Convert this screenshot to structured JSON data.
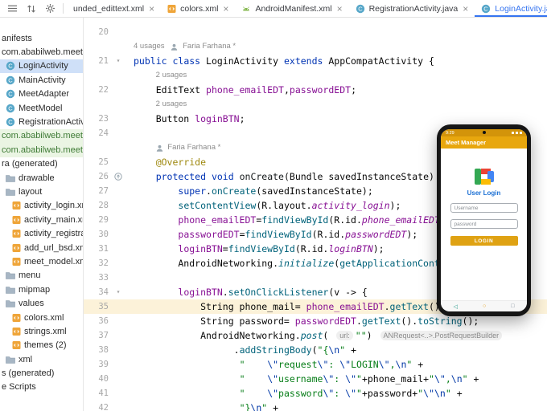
{
  "theme": {
    "accent": "#3574F0",
    "selection_bg": "#CFE0F8",
    "vcs_added_bg": "#EAF5E3",
    "vcs_added_text": "#3F7B36",
    "caret_line_bg": "#FCF2D9",
    "syntax": {
      "keyword": "#0033B3",
      "field": "#871094",
      "method_call": "#00627A",
      "string": "#067D17",
      "escape": "#0037A6",
      "annotation": "#9E880D",
      "text": "#080808",
      "inlay_hint": "#8C8C8C"
    }
  },
  "toolbar": {
    "icons": [
      "menu",
      "sort",
      "gear"
    ]
  },
  "tabs": [
    {
      "label": "unded_edittext.xml",
      "icon": null,
      "active": false,
      "closable": true
    },
    {
      "label": "colors.xml",
      "icon": "xml",
      "active": false,
      "closable": true
    },
    {
      "label": "AndroidManifest.xml",
      "icon": "manifest",
      "active": false,
      "closable": true
    },
    {
      "label": "RegistrationActivity.java",
      "icon": "cls",
      "active": false,
      "closable": true
    },
    {
      "label": "LoginActivity.ja",
      "icon": "cls",
      "active": true,
      "closable": false
    }
  ],
  "close_glyph": "×",
  "project_tree": {
    "items": [
      {
        "label": "anifests",
        "icon": null,
        "level": 0
      },
      {
        "label": "com.ababilweb.meetm",
        "icon": null,
        "level": 0
      },
      {
        "label": "LoginActivity",
        "icon": "cls",
        "level": 1,
        "state": "selected"
      },
      {
        "label": "MainActivity",
        "icon": "cls",
        "level": 1
      },
      {
        "label": "MeetAdapter",
        "icon": "cls",
        "level": 1
      },
      {
        "label": "MeetModel",
        "icon": "cls",
        "level": 1
      },
      {
        "label": "RegistrationActivity",
        "icon": "cls",
        "level": 1
      },
      {
        "label": "com.ababilweb.meetma",
        "icon": null,
        "level": 0,
        "state": "vcs"
      },
      {
        "label": "com.ababilweb.meetma",
        "icon": null,
        "level": 0,
        "state": "vcs"
      },
      {
        "label": "ra (generated)",
        "icon": null,
        "level": 0
      },
      {
        "label": "drawable",
        "icon": "folder",
        "level": 1
      },
      {
        "label": "layout",
        "icon": "folder",
        "level": 1
      },
      {
        "label": "activity_login.xml",
        "icon": "xml",
        "level": 2
      },
      {
        "label": "activity_main.xml",
        "icon": "xml",
        "level": 2
      },
      {
        "label": "activity_registration.x",
        "icon": "xml",
        "level": 2
      },
      {
        "label": "add_url_bsd.xml",
        "icon": "xml",
        "level": 2
      },
      {
        "label": "meet_model.xml",
        "icon": "xml",
        "level": 2
      },
      {
        "label": "menu",
        "icon": "folder",
        "level": 1
      },
      {
        "label": "mipmap",
        "icon": "folder",
        "level": 1
      },
      {
        "label": "values",
        "icon": "folder",
        "level": 1
      },
      {
        "label": "colors.xml",
        "icon": "xml",
        "level": 2
      },
      {
        "label": "strings.xml",
        "icon": "xml",
        "level": 2
      },
      {
        "label": "themes (2)",
        "icon": "xml",
        "level": 2
      },
      {
        "label": "xml",
        "icon": "folder",
        "level": 1
      },
      {
        "label": "s (generated)",
        "icon": null,
        "level": 0
      },
      {
        "label": "e Scripts",
        "icon": null,
        "level": 0
      }
    ]
  },
  "editor": {
    "lines": [
      {
        "num": 20,
        "tokens": []
      },
      {
        "type": "inlay",
        "indent": 0,
        "tokens": [
          {
            "c": "hint",
            "t": "4 usages   "
          },
          {
            "c": "icon-person",
            "t": ""
          },
          {
            "c": "hint",
            "t": " Faria Farhana *"
          }
        ]
      },
      {
        "num": 21,
        "mark": "fold",
        "tokens": [
          {
            "c": "kw",
            "t": "public"
          },
          {
            "c": "txt",
            "t": " "
          },
          {
            "c": "kw",
            "t": "class"
          },
          {
            "c": "txt",
            "t": " LoginActivity "
          },
          {
            "c": "kw",
            "t": "extends"
          },
          {
            "c": "txt",
            "t": " AppCompatActivity {"
          }
        ]
      },
      {
        "type": "inlay",
        "indent": 4,
        "tokens": [
          {
            "c": "hint",
            "t": "2 usages"
          }
        ]
      },
      {
        "num": 22,
        "tokens": [
          {
            "c": "txt",
            "t": "    EditText "
          },
          {
            "c": "fld",
            "t": "phone_emailEDT"
          },
          {
            "c": "txt",
            "t": ","
          },
          {
            "c": "fld",
            "t": "passwordEDT"
          },
          {
            "c": "txt",
            "t": ";"
          }
        ]
      },
      {
        "type": "inlay",
        "indent": 4,
        "tokens": [
          {
            "c": "hint",
            "t": "2 usages"
          }
        ]
      },
      {
        "num": 23,
        "tokens": [
          {
            "c": "txt",
            "t": "    Button "
          },
          {
            "c": "fld",
            "t": "loginBTN"
          },
          {
            "c": "txt",
            "t": ";"
          }
        ]
      },
      {
        "num": 24,
        "tokens": []
      },
      {
        "type": "inlay",
        "indent": 4,
        "tokens": [
          {
            "c": "icon-person",
            "t": ""
          },
          {
            "c": "hint",
            "t": " Faria Farhana *"
          }
        ]
      },
      {
        "num": 25,
        "tokens": [
          {
            "c": "txt",
            "t": "    "
          },
          {
            "c": "ann",
            "t": "@Override"
          }
        ]
      },
      {
        "num": 26,
        "mark": "override",
        "tokens": [
          {
            "c": "txt",
            "t": "    "
          },
          {
            "c": "kw",
            "t": "protected"
          },
          {
            "c": "txt",
            "t": " "
          },
          {
            "c": "kw",
            "t": "void"
          },
          {
            "c": "txt",
            "t": " "
          },
          {
            "c": "decl",
            "t": "onCreate"
          },
          {
            "c": "txt",
            "t": "(Bundle savedInstanceState) {"
          }
        ]
      },
      {
        "num": 27,
        "tokens": [
          {
            "c": "txt",
            "t": "        "
          },
          {
            "c": "kw",
            "t": "super"
          },
          {
            "c": "txt",
            "t": "."
          },
          {
            "c": "mth",
            "t": "onCreate"
          },
          {
            "c": "txt",
            "t": "(savedInstanceState);"
          }
        ]
      },
      {
        "num": 28,
        "tokens": [
          {
            "c": "txt",
            "t": "        "
          },
          {
            "c": "mth",
            "t": "setContentView"
          },
          {
            "c": "txt",
            "t": "(R.layout."
          },
          {
            "c": "sfld",
            "t": "activity_login"
          },
          {
            "c": "txt",
            "t": ");"
          }
        ]
      },
      {
        "num": 29,
        "tokens": [
          {
            "c": "txt",
            "t": "        "
          },
          {
            "c": "fld",
            "t": "phone_emailEDT"
          },
          {
            "c": "txt",
            "t": "="
          },
          {
            "c": "mth",
            "t": "findViewById"
          },
          {
            "c": "txt",
            "t": "(R.id."
          },
          {
            "c": "sfld",
            "t": "phone_emailEDT"
          },
          {
            "c": "txt",
            "t": ");"
          }
        ]
      },
      {
        "num": 30,
        "tokens": [
          {
            "c": "txt",
            "t": "        "
          },
          {
            "c": "fld",
            "t": "passwordEDT"
          },
          {
            "c": "txt",
            "t": "="
          },
          {
            "c": "mth",
            "t": "findViewById"
          },
          {
            "c": "txt",
            "t": "(R.id."
          },
          {
            "c": "sfld",
            "t": "passwordEDT"
          },
          {
            "c": "txt",
            "t": ");"
          }
        ]
      },
      {
        "num": 31,
        "tokens": [
          {
            "c": "txt",
            "t": "        "
          },
          {
            "c": "fld",
            "t": "loginBTN"
          },
          {
            "c": "txt",
            "t": "="
          },
          {
            "c": "mth",
            "t": "findViewById"
          },
          {
            "c": "txt",
            "t": "(R.id."
          },
          {
            "c": "sfld",
            "t": "loginBTN"
          },
          {
            "c": "txt",
            "t": ");"
          }
        ]
      },
      {
        "num": 32,
        "tokens": [
          {
            "c": "txt",
            "t": "        AndroidNetworking."
          },
          {
            "c": "smth",
            "t": "initialize"
          },
          {
            "c": "txt",
            "t": "("
          },
          {
            "c": "mth",
            "t": "getApplicationContext"
          },
          {
            "c": "txt",
            "t": "());"
          }
        ]
      },
      {
        "num": 33,
        "tokens": []
      },
      {
        "num": 34,
        "mark": "fold",
        "tokens": [
          {
            "c": "txt",
            "t": "        "
          },
          {
            "c": "fld",
            "t": "loginBTN"
          },
          {
            "c": "txt",
            "t": "."
          },
          {
            "c": "mth",
            "t": "setOnClickListener"
          },
          {
            "c": "txt",
            "t": "(v -> {"
          }
        ]
      },
      {
        "num": 35,
        "hl": true,
        "tokens": [
          {
            "c": "txt",
            "t": "            String phone_mail= "
          },
          {
            "c": "fld",
            "t": "phone_emailEDT"
          },
          {
            "c": "txt",
            "t": "."
          },
          {
            "c": "mth",
            "t": "getText"
          },
          {
            "c": "txt",
            "t": "()."
          },
          {
            "c": "mth",
            "t": "toString"
          },
          {
            "c": "txt",
            "t": "();"
          }
        ]
      },
      {
        "num": 36,
        "tokens": [
          {
            "c": "txt",
            "t": "            String password= "
          },
          {
            "c": "fld",
            "t": "passwordEDT"
          },
          {
            "c": "txt",
            "t": "."
          },
          {
            "c": "mth",
            "t": "getText"
          },
          {
            "c": "txt",
            "t": "()."
          },
          {
            "c": "mth",
            "t": "toString"
          },
          {
            "c": "txt",
            "t": "();"
          }
        ]
      },
      {
        "num": 37,
        "tokens": [
          {
            "c": "txt",
            "t": "            AndroidNetworking."
          },
          {
            "c": "smth",
            "t": "post"
          },
          {
            "c": "txt",
            "t": "( "
          },
          {
            "c": "chip",
            "t": "url:"
          },
          {
            "c": "str",
            "t": "\"\""
          },
          {
            "c": "txt",
            "t": ") "
          },
          {
            "c": "chip",
            "t": "ANRequest<..>.PostRequestBuilder"
          }
        ]
      },
      {
        "num": 38,
        "tokens": [
          {
            "c": "txt",
            "t": "                  ."
          },
          {
            "c": "mth",
            "t": "addStringBody"
          },
          {
            "c": "txt",
            "t": "("
          },
          {
            "c": "str",
            "t": "\"{"
          },
          {
            "c": "esc",
            "t": "\\n"
          },
          {
            "c": "str",
            "t": "\""
          },
          {
            "c": "txt",
            "t": " +"
          }
        ]
      },
      {
        "num": 39,
        "tokens": [
          {
            "c": "txt",
            "t": "                   "
          },
          {
            "c": "str",
            "t": "\"    "
          },
          {
            "c": "esc",
            "t": "\\\""
          },
          {
            "c": "str",
            "t": "request"
          },
          {
            "c": "esc",
            "t": "\\\""
          },
          {
            "c": "str",
            "t": ": "
          },
          {
            "c": "esc",
            "t": "\\\""
          },
          {
            "c": "str",
            "t": "LOGIN"
          },
          {
            "c": "esc",
            "t": "\\\""
          },
          {
            "c": "str",
            "t": ","
          },
          {
            "c": "esc",
            "t": "\\n"
          },
          {
            "c": "str",
            "t": "\""
          },
          {
            "c": "txt",
            "t": " +"
          }
        ]
      },
      {
        "num": 40,
        "tokens": [
          {
            "c": "txt",
            "t": "                   "
          },
          {
            "c": "str",
            "t": "\"    "
          },
          {
            "c": "esc",
            "t": "\\\""
          },
          {
            "c": "str",
            "t": "username"
          },
          {
            "c": "esc",
            "t": "\\\""
          },
          {
            "c": "str",
            "t": ": "
          },
          {
            "c": "esc",
            "t": "\\\""
          },
          {
            "c": "str",
            "t": "\""
          },
          {
            "c": "txt",
            "t": "+phone_mail+"
          },
          {
            "c": "str",
            "t": "\""
          },
          {
            "c": "esc",
            "t": "\\\""
          },
          {
            "c": "str",
            "t": ","
          },
          {
            "c": "esc",
            "t": "\\n"
          },
          {
            "c": "str",
            "t": "\""
          },
          {
            "c": "txt",
            "t": " +"
          }
        ]
      },
      {
        "num": 41,
        "tokens": [
          {
            "c": "txt",
            "t": "                   "
          },
          {
            "c": "str",
            "t": "\"    "
          },
          {
            "c": "esc",
            "t": "\\\""
          },
          {
            "c": "str",
            "t": "password"
          },
          {
            "c": "esc",
            "t": "\\\""
          },
          {
            "c": "str",
            "t": ": "
          },
          {
            "c": "esc",
            "t": "\\\""
          },
          {
            "c": "str",
            "t": "\""
          },
          {
            "c": "txt",
            "t": "+password+"
          },
          {
            "c": "str",
            "t": "\""
          },
          {
            "c": "esc",
            "t": "\\\""
          },
          {
            "c": "esc",
            "t": "\\n"
          },
          {
            "c": "str",
            "t": "\""
          },
          {
            "c": "txt",
            "t": " +"
          }
        ]
      },
      {
        "num": 42,
        "tokens": [
          {
            "c": "txt",
            "t": "                   "
          },
          {
            "c": "str",
            "t": "\"}"
          },
          {
            "c": "esc",
            "t": "\\n"
          },
          {
            "c": "str",
            "t": "\""
          },
          {
            "c": "txt",
            "t": " +"
          }
        ]
      }
    ]
  },
  "device_preview": {
    "time": "9:29",
    "app_title": "Meet Manager",
    "login_heading": "User Login",
    "username_field": "Username",
    "password_field": "password",
    "login_button": "LOGIN",
    "nav": {
      "back": "◁",
      "home": "○",
      "recents": "□"
    },
    "colors": {
      "app_bar": "#E8A70E",
      "button": "#DFA213",
      "heading": "#1A6FD4"
    }
  }
}
